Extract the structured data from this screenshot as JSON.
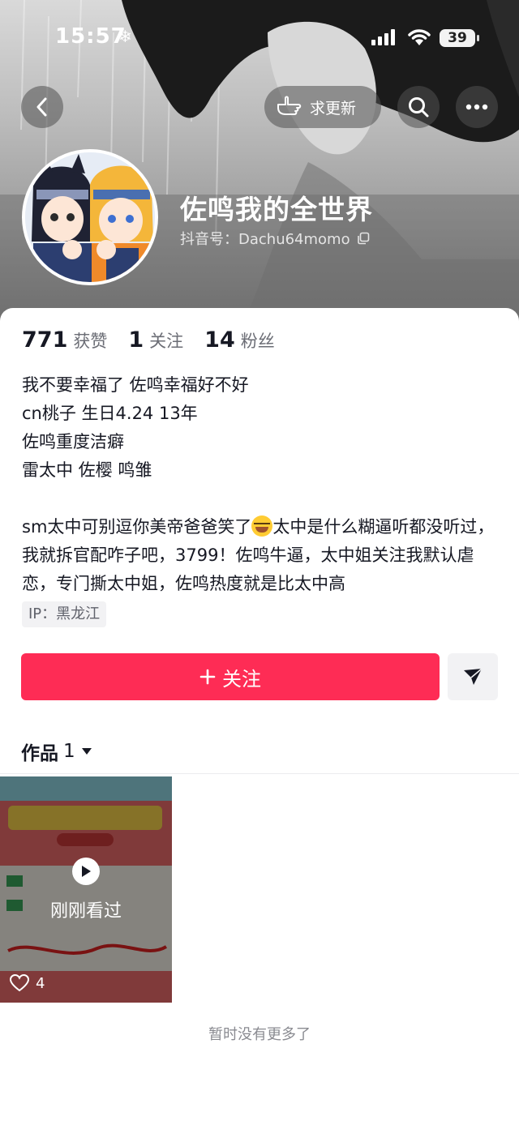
{
  "status_bar": {
    "time": "15:57",
    "battery": "39"
  },
  "header": {
    "update_label": "求更新"
  },
  "profile": {
    "nickname": "佐鸣我的全世界",
    "douyin_id": "抖音号：Dachu64momo"
  },
  "stats": [
    {
      "value": "771",
      "label": "获赞"
    },
    {
      "value": "1",
      "label": "关注"
    },
    {
      "value": "14",
      "label": "粉丝"
    }
  ],
  "bio": {
    "line1": "我不要幸福了 佐鸣幸福好不好",
    "line2": "cn桃子 生日4.24 13年",
    "line3": "佐鸣重度洁癖",
    "line4": "雷太中 佐樱 鸣雏",
    "para_part1": "sm太中可别逗你美帝爸爸笑了",
    "para_part2": "太中是什么糊逼听都没听过，我就拆官配咋子吧，3799！佐鸣牛逼，太中姐关注我默认虐恋，专门撕太中姐，佐鸣热度就是比太中高"
  },
  "ip": "IP：黑龙江",
  "actions": {
    "follow_label": "关注"
  },
  "works": {
    "tab_label": "作品",
    "count": "1",
    "items": [
      {
        "watched_label": "刚刚看过",
        "likes": "4"
      }
    ]
  },
  "footer": {
    "no_more": "暂时没有更多了"
  },
  "colors": {
    "accent": "#fe2c55",
    "text": "#161823",
    "muted": "#6b6d75"
  }
}
